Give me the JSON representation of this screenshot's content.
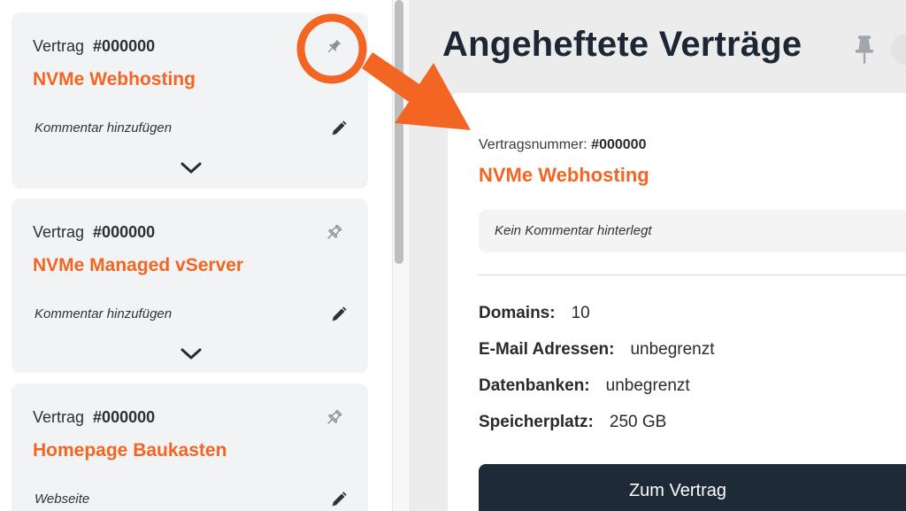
{
  "contracts": [
    {
      "label": "Vertrag",
      "number": "#000000",
      "title": "NVMe Webhosting",
      "comment": "Kommentar hinzufügen",
      "pinned": true
    },
    {
      "label": "Vertrag",
      "number": "#000000",
      "title": "NVMe Managed vServer",
      "comment": "Kommentar hinzufügen",
      "pinned": false
    },
    {
      "label": "Vertrag",
      "number": "#000000",
      "title": "Homepage Baukasten",
      "comment": "Webseite",
      "pinned": false
    }
  ],
  "pinned_panel": {
    "heading": "Angeheftete Verträge",
    "contract_number_label": "Vertragsnummer:",
    "contract_number": "#000000",
    "title": "NVMe Webhosting",
    "comment": "Kein Kommentar hinterlegt",
    "specs": [
      {
        "key": "Domains:",
        "value": "10"
      },
      {
        "key": "E-Mail Adressen:",
        "value": "unbegrenzt"
      },
      {
        "key": "Datenbanken:",
        "value": "unbegrenzt"
      },
      {
        "key": "Speicherplatz:",
        "value": "250 GB"
      }
    ],
    "button_label": "Zum Vertrag"
  },
  "colors": {
    "accent": "#f26522",
    "dark": "#1e2a38",
    "card_bg": "#f2f3f5",
    "annotation": "#f26522"
  },
  "icons": {
    "pin_filled": "pin-filled-icon",
    "pin_outline": "pin-outline-icon",
    "edit": "pencil-icon",
    "expand": "chevron-down-icon"
  }
}
